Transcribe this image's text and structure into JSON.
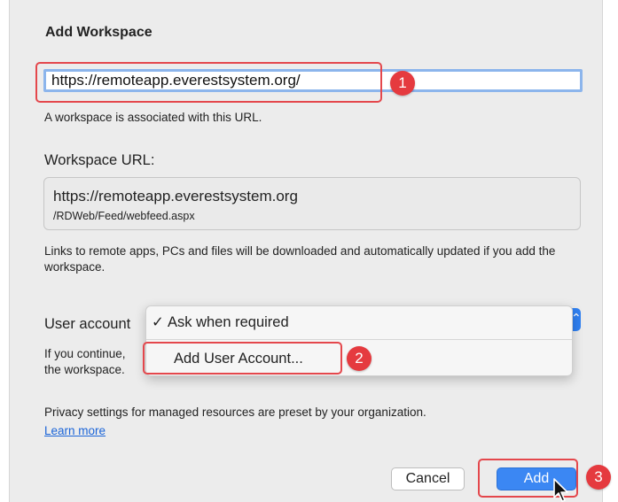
{
  "dialog": {
    "title": "Add Workspace",
    "url_input_value": "https://remoteapp.everestsystem.org/",
    "url_hint": "A workspace is associated with this URL.",
    "workspace_url_label": "Workspace URL:",
    "workspace_url_line1": "https://remoteapp.everestsystem.org",
    "workspace_url_line2": "/RDWeb/Feed/webfeed.aspx",
    "download_note": "Links to remote apps, PCs and files will be downloaded and automatically updated if you add the workspace.",
    "user_account_label": "User account",
    "continue_note_line1": "If you continue,",
    "continue_note_line2": "the workspace.",
    "privacy_note": "Privacy settings for managed resources are preset by your organization.",
    "learn_more": "Learn more",
    "cancel_label": "Cancel",
    "add_label": "Add"
  },
  "user_account_menu": {
    "selected_item": "Ask when required",
    "check_glyph": "✓",
    "add_item": "Add User Account..."
  },
  "callouts": [
    "1",
    "2",
    "3"
  ],
  "colors": {
    "accent": "#3b87f3",
    "callout": "#e53a3f",
    "focus_ring": "#8cb5ec"
  }
}
